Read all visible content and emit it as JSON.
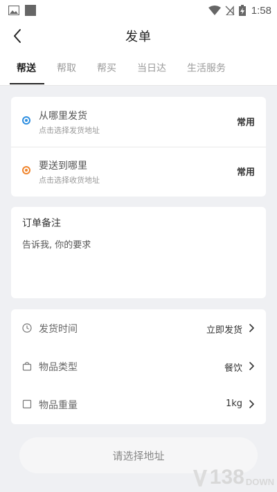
{
  "status_bar": {
    "time": "1:58",
    "icons": [
      "image-icon",
      "square-icon",
      "wifi-icon",
      "no-sim-icon",
      "battery-charging-icon"
    ]
  },
  "header": {
    "title": "发单",
    "back_icon": "chevron-left-icon"
  },
  "tabs": [
    {
      "label": "帮送",
      "active": true
    },
    {
      "label": "帮取",
      "active": false
    },
    {
      "label": "帮买",
      "active": false
    },
    {
      "label": "当日达",
      "active": false
    },
    {
      "label": "生活服务",
      "active": false
    }
  ],
  "address": {
    "from": {
      "title": "从哪里发货",
      "subtitle": "点击选择发货地址",
      "action": "常用",
      "dot_color": "#2d8ee0"
    },
    "to": {
      "title": "要送到哪里",
      "subtitle": "点击选择收货地址",
      "action": "常用",
      "dot_color": "#f0852d"
    }
  },
  "remark": {
    "title": "订单备注",
    "placeholder": "告诉我, 你的要求"
  },
  "options": [
    {
      "label": "发货时间",
      "value": "立即发货",
      "icon": "clock-icon"
    },
    {
      "label": "物品类型",
      "value": "餐饮",
      "icon": "bag-icon"
    },
    {
      "label": "物品重量",
      "value": "1kg",
      "icon": "square-outline-icon"
    }
  ],
  "submit_label": "请选择地址",
  "watermark": {
    "number": "138",
    "suffix": "DOWN"
  }
}
